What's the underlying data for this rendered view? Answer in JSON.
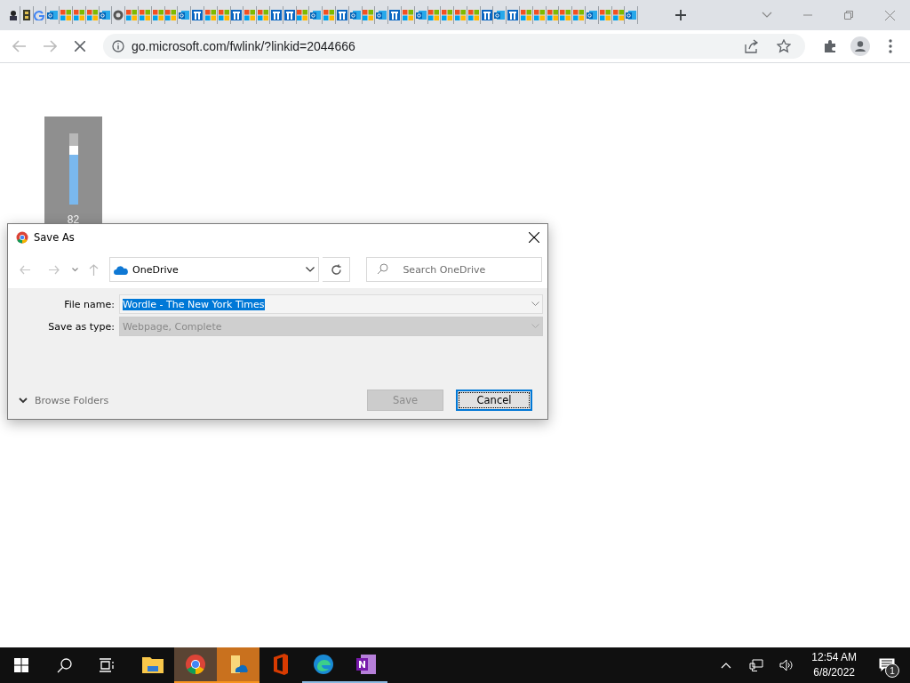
{
  "browser": {
    "tabs": [
      {
        "kind": "spy"
      },
      {
        "kind": "film"
      },
      {
        "kind": "google"
      },
      {
        "kind": "outlook"
      },
      {
        "kind": "windows"
      },
      {
        "kind": "windows"
      },
      {
        "kind": "windows"
      },
      {
        "kind": "outlook"
      },
      {
        "kind": "chrome"
      },
      {
        "kind": "windows"
      },
      {
        "kind": "windows"
      },
      {
        "kind": "windows"
      },
      {
        "kind": "windows"
      },
      {
        "kind": "outlook"
      },
      {
        "kind": "linkedin"
      },
      {
        "kind": "windows"
      },
      {
        "kind": "windows"
      },
      {
        "kind": "linkedin"
      },
      {
        "kind": "windows"
      },
      {
        "kind": "windows"
      },
      {
        "kind": "linkedin"
      },
      {
        "kind": "linkedin"
      },
      {
        "kind": "windows"
      },
      {
        "kind": "outlook"
      },
      {
        "kind": "windows"
      },
      {
        "kind": "linkedin"
      },
      {
        "kind": "outlook"
      },
      {
        "kind": "windows"
      },
      {
        "kind": "outlook"
      },
      {
        "kind": "linkedin"
      },
      {
        "kind": "windows"
      },
      {
        "kind": "outlook"
      },
      {
        "kind": "windows"
      },
      {
        "kind": "windows"
      },
      {
        "kind": "windows"
      },
      {
        "kind": "windows"
      },
      {
        "kind": "linkedin"
      },
      {
        "kind": "outlook"
      },
      {
        "kind": "linkedin"
      },
      {
        "kind": "windows"
      },
      {
        "kind": "windows"
      },
      {
        "kind": "windows"
      },
      {
        "kind": "windows"
      },
      {
        "kind": "windows"
      },
      {
        "kind": "outlook"
      },
      {
        "kind": "windows"
      },
      {
        "kind": "windows"
      },
      {
        "kind": "outlook"
      }
    ],
    "address": "go.microsoft.com/fwlink/?linkid=2044666"
  },
  "volume_overlay": {
    "level": 0.82,
    "reading": "82"
  },
  "dialog": {
    "title": "Save As",
    "location": "OneDrive",
    "search": {
      "placeholder": "Search OneDrive"
    },
    "fields": [
      {
        "label": "File name:",
        "value": "Wordle - The New York Times",
        "text_selected": true,
        "disabled": false
      },
      {
        "label": "Save as type:",
        "value": "Webpage, Complete",
        "text_selected": false,
        "disabled": true
      }
    ],
    "browse_folders": {
      "label": "Browse Folders",
      "expanded": false
    },
    "buttons": [
      {
        "label": "Save",
        "disabled": true,
        "focused": false
      },
      {
        "label": "Cancel",
        "disabled": false,
        "focused": true
      }
    ]
  },
  "taskbar": {
    "apps": [
      {
        "kind": "explorer",
        "running": false,
        "attention": false,
        "active": false
      },
      {
        "kind": "chrome",
        "running": true,
        "attention": true,
        "active": true
      },
      {
        "kind": "onedrive_folder",
        "running": true,
        "attention": true,
        "active": false
      },
      {
        "kind": "office",
        "running": false,
        "attention": false,
        "active": false
      },
      {
        "kind": "edge",
        "running": true,
        "attention": false,
        "active": false
      },
      {
        "kind": "onenote",
        "running": true,
        "attention": false,
        "active": false
      }
    ],
    "time": "12:54 AM",
    "date": "6/8/2022",
    "notifications": "1"
  }
}
